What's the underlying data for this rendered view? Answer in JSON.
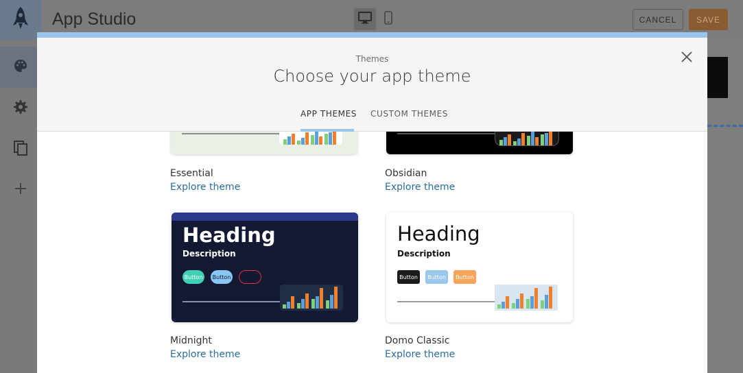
{
  "app": {
    "title": "App Studio",
    "cancel_label": "CANCEL",
    "save_label": "SAVE"
  },
  "modal": {
    "overline": "Themes",
    "title": "Choose your app theme",
    "tabs": [
      {
        "label": "APP THEMES",
        "active": true
      },
      {
        "label": "CUSTOM THEMES",
        "active": false
      }
    ]
  },
  "themes": [
    {
      "name": "Essential",
      "link": "Explore theme"
    },
    {
      "name": "Obsidian",
      "link": "Explore theme"
    },
    {
      "name": "Midnight",
      "link": "Explore theme",
      "preview": {
        "heading": "Heading",
        "description": "Description",
        "buttons": [
          "Button",
          "Button",
          "Button"
        ]
      }
    },
    {
      "name": "Domo Classic",
      "link": "Explore theme",
      "preview": {
        "heading": "Heading",
        "description": "Description",
        "buttons": [
          "Button",
          "Button",
          "Button"
        ]
      }
    }
  ],
  "colors": {
    "accent_blue": "#99c6ea",
    "link_blue": "#2a6d9c",
    "save_orange": "#e27e31",
    "chart_orange": "#f2802b",
    "chart_blue": "#5a9fdc",
    "chart_green": "#7ed07a"
  },
  "icons": {
    "logo": "rocket-icon",
    "rail": [
      "palette-icon",
      "gear-icon",
      "copy-icon",
      "plus-icon"
    ],
    "devices": [
      "desktop-icon",
      "mobile-icon"
    ],
    "close": "close-icon"
  }
}
